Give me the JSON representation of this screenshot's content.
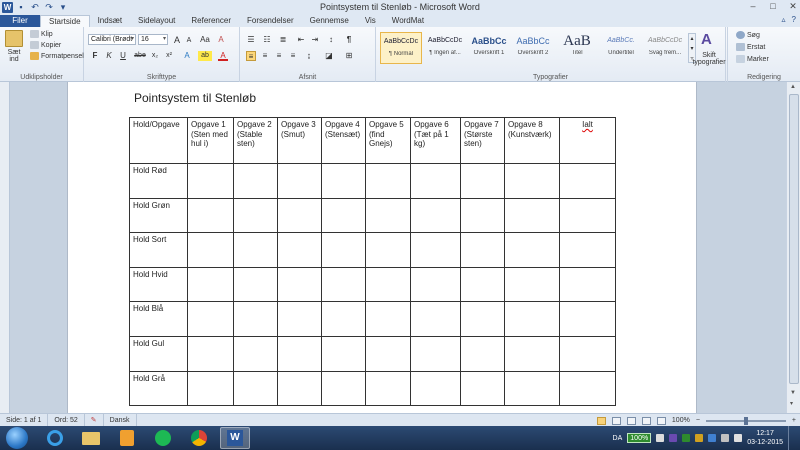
{
  "window": {
    "title": "Pointsystem til Stenløb  -  Microsoft Word",
    "app_logo": "W"
  },
  "tabs": [
    "Filer",
    "Startside",
    "Indsæt",
    "Sidelayout",
    "Referencer",
    "Forsendelser",
    "Gennemse",
    "Vis",
    "WordMat"
  ],
  "active_tab": "Startside",
  "ribbon": {
    "clipboard": {
      "paste_label": "Sæt ind",
      "cut": "Klip",
      "copy": "Kopier",
      "format_painter": "Formatpensel",
      "group": "Udklipsholder"
    },
    "font": {
      "font_name": "Calibri (Brødt",
      "font_size": "16",
      "group": "Skrifttype",
      "bold": "F",
      "italic": "K",
      "underline": "U",
      "strike": "abe",
      "subscript": "x₂",
      "superscript": "x²",
      "grow": "A",
      "shrink": "A",
      "case": "Aa",
      "clear": "A",
      "text_effects": "A",
      "highlight": "ab",
      "font_color": "A"
    },
    "paragraph": {
      "group": "Afsnit",
      "show_marks": "¶"
    },
    "styles": {
      "group": "Typografier",
      "items": [
        {
          "sample": "AaBbCcDc",
          "name": "¶ Normal"
        },
        {
          "sample": "AaBbCcDc",
          "name": "¶ Ingen af..."
        },
        {
          "sample": "AaBbCc",
          "name": "Overskrift 1"
        },
        {
          "sample": "AaBbCc",
          "name": "Overskrift 2"
        },
        {
          "sample": "AaB",
          "name": "Titel"
        },
        {
          "sample": "AaBbCc.",
          "name": "Undertitel"
        },
        {
          "sample": "AaBbCcDc",
          "name": "Svag frem..."
        }
      ],
      "change_styles": "Skift typografier"
    },
    "editing": {
      "group": "Redigering",
      "find": "Søg",
      "replace": "Erstat",
      "select": "Marker"
    }
  },
  "document": {
    "title": "Pointsystem  til Stenløb",
    "headers": [
      "Hold/Opgave",
      "Opgave 1 (Sten med hul i)",
      "Opgave 2 (Stable sten)",
      "Opgave 3 (Smut)",
      "Opgave 4 (Stensæt)",
      "Opgave 5 (find Gnejs)",
      "Opgave 6 (Tæt på 1 kg)",
      "Opgave 7 (Største sten)",
      "Opgave 8 (Kunstværk)",
      "Ialt"
    ],
    "rows": [
      "Hold Rød",
      "Hold Grøn",
      "Hold Sort",
      "Hold Hvid",
      "Hold Blå",
      "Hold Gul",
      "Hold Grå"
    ]
  },
  "status": {
    "page": "Side: 1 af 1",
    "words": "Ord: 52",
    "language": "Dansk",
    "zoom": "100%"
  },
  "taskbar": {
    "language": "DA",
    "battery": "100%",
    "time": "12:17",
    "date": "03-12-2015"
  },
  "colors": {
    "file_tab": "#2b579a",
    "selected_style": "#fdf1c8",
    "taskbar": "#1a2f4e"
  }
}
